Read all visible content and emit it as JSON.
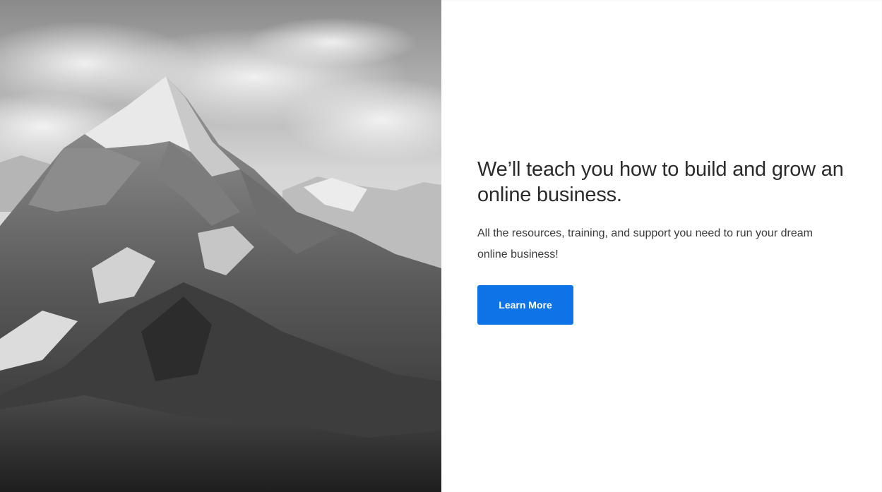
{
  "hero": {
    "image_alt": "mountain-photo"
  },
  "content": {
    "headline": "We’ll teach you how to build and grow an online business.",
    "subtext": "All the resources, training, and support you need to run your dream online business!",
    "cta_label": "Learn More"
  },
  "colors": {
    "accent": "#0d73e6",
    "text": "#2b2b2b"
  }
}
